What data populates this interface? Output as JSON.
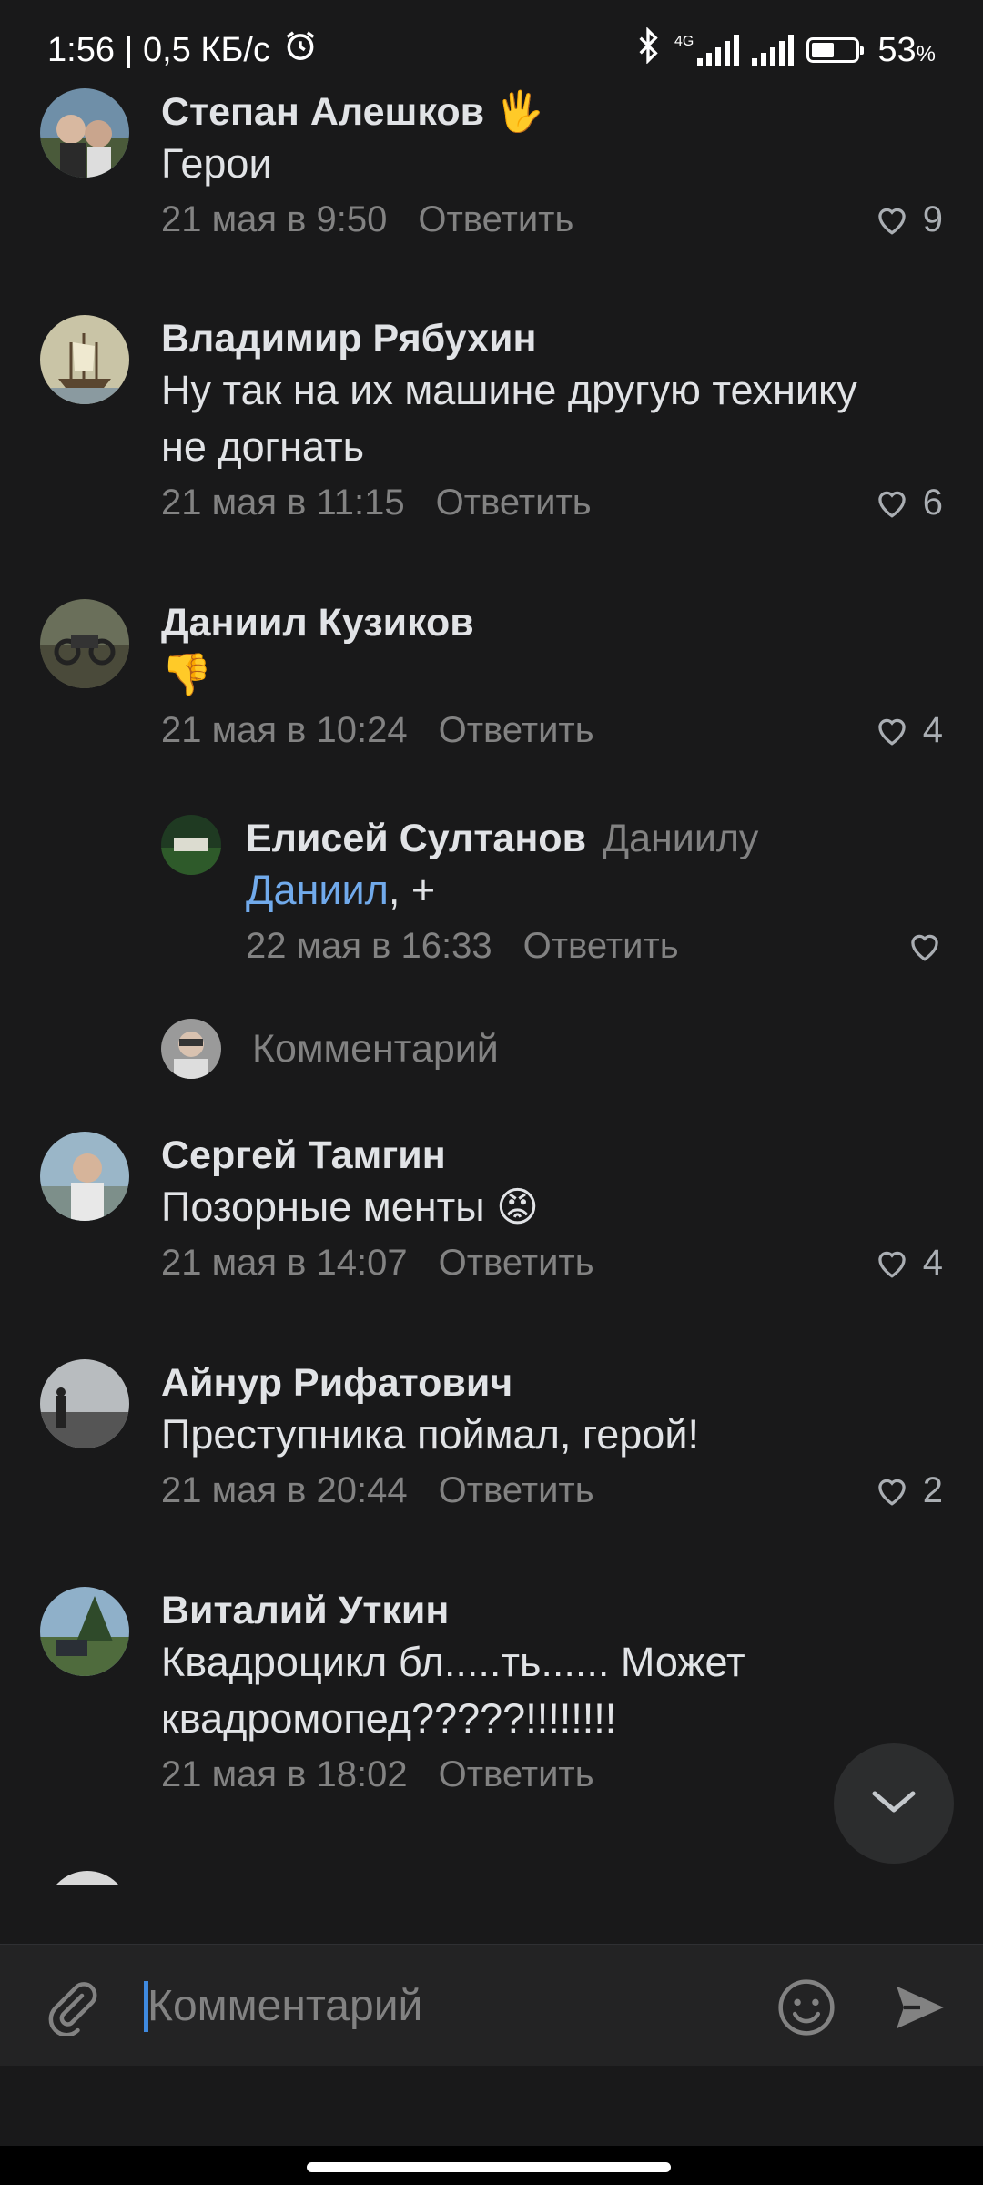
{
  "status_bar": {
    "time_speed": "1:56 | 0,5 КБ/с",
    "network": "4G",
    "battery": "53",
    "battery_unit": "%"
  },
  "comments": [
    {
      "author": "Степан Алешков",
      "text": "Герои",
      "date": "21 мая в 9:50",
      "reply_label": "Ответить",
      "likes": "9"
    },
    {
      "author": "Владимир Рябухин",
      "text_line1": "Ну так на их машине другую технику",
      "text_line2": "не догнать",
      "date": "21 мая в 11:15",
      "reply_label": "Ответить",
      "likes": "6"
    },
    {
      "author": "Даниил Кузиков",
      "emoji": "👎",
      "date": "21 мая в 10:24",
      "reply_label": "Ответить",
      "likes": "4"
    },
    {
      "author": "Сергей Тамгин",
      "text": "Позорные менты",
      "emoji": "😡",
      "date": "21 мая в 14:07",
      "reply_label": "Ответить",
      "likes": "4"
    },
    {
      "author": "Айнур Рифатович",
      "text": "Преступника поймал, герой!",
      "date": "21 мая в 20:44",
      "reply_label": "Ответить",
      "likes": "2"
    },
    {
      "author": "Виталий Уткин",
      "text_line1": "Квадроцикл бл.....ть...... Может",
      "text_line2": "квадромопед?????!!!!!!!!",
      "date": "21 мая в 18:02",
      "reply_label": "Ответить"
    }
  ],
  "reply": {
    "author": "Елисей Султанов",
    "to": "Даниилу",
    "mention": "Даниил",
    "text": ", +",
    "date": "22 мая в 16:33",
    "reply_label": "Ответить"
  },
  "thread_reply_placeholder": "Комментарий",
  "composer": {
    "placeholder": "Комментарий"
  },
  "colors": {
    "background": "#19191a",
    "link": "#71aaeb",
    "secondary": "#828282",
    "accent_caret": "#3f8ae0"
  }
}
